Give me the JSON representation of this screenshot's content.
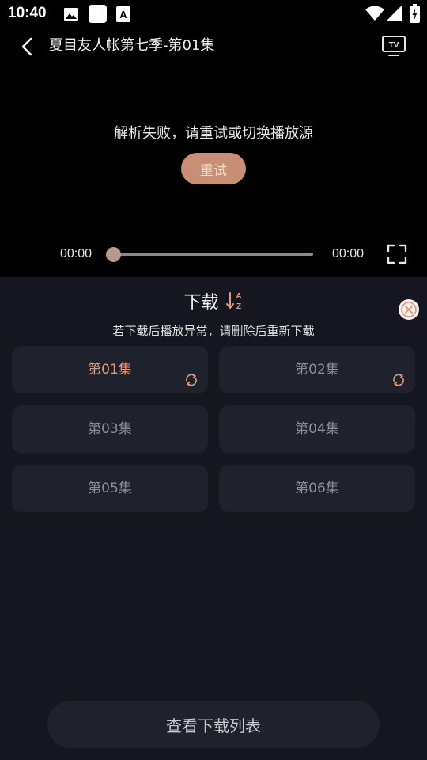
{
  "status_bar": {
    "time": "10:40",
    "icons": [
      "image-icon",
      "square-icon",
      "a-icon",
      "wifi-icon",
      "signal-icon",
      "battery-icon"
    ]
  },
  "player": {
    "title": "夏目友人帐第七季-第01集",
    "error_message": "解析失败，请重试或切换播放源",
    "retry_label": "重试",
    "current_time": "00:00",
    "total_time": "00:00",
    "progress": 0,
    "tv_label": "TV"
  },
  "download_panel": {
    "title": "下载",
    "hint": "若下载后播放异常，请删除后重新下载",
    "episodes": [
      {
        "label": "第01集",
        "active": true,
        "downloading": true
      },
      {
        "label": "第02集",
        "active": false,
        "downloading": true
      },
      {
        "label": "第03集",
        "active": false,
        "downloading": false
      },
      {
        "label": "第04集",
        "active": false,
        "downloading": false
      },
      {
        "label": "第05集",
        "active": false,
        "downloading": false
      },
      {
        "label": "第06集",
        "active": false,
        "downloading": false
      }
    ],
    "view_list_label": "查看下载列表"
  },
  "colors": {
    "accent": "#e79a7a",
    "retry_bg": "#c98e76",
    "panel_bg": "#15161f",
    "card_bg": "#1f212c"
  }
}
